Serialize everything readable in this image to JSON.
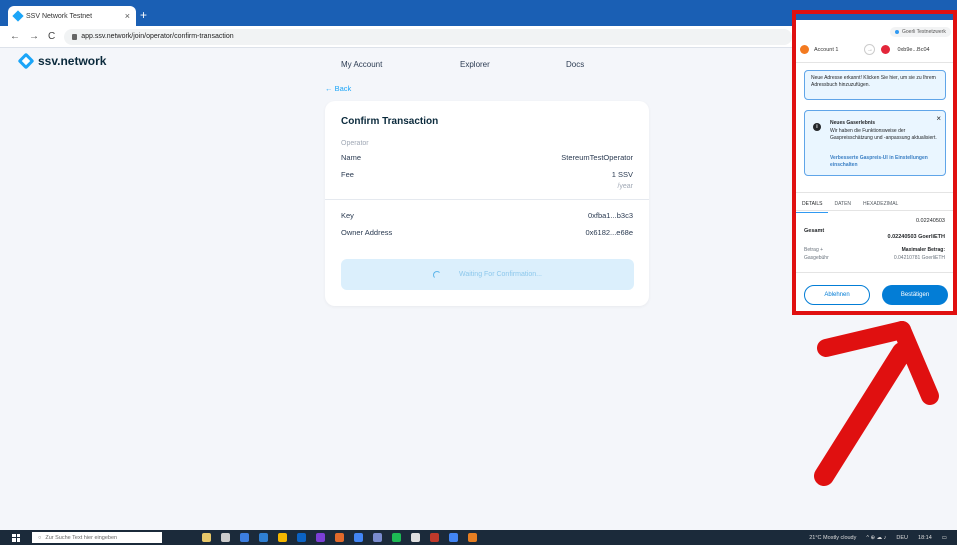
{
  "browser": {
    "tab_title": "SSV Network Testnet",
    "tab_close": "×",
    "new_tab": "+",
    "url": "app.ssv.network/join/operator/confirm-transaction",
    "back": "←",
    "forward": "→",
    "reload": "C"
  },
  "app": {
    "logo_text": "ssv.network",
    "nav": [
      "My Account",
      "Explorer",
      "Docs"
    ],
    "back_link": "← Back",
    "card": {
      "title": "Confirm Transaction",
      "section_label": "Operator",
      "name_label": "Name",
      "name_value": "StereumTestOperator",
      "fee_label": "Fee",
      "fee_value": "1 SSV",
      "fee_unit": "/year",
      "key_label": "Key",
      "key_value": "0xfba1...b3c3",
      "owner_label": "Owner Address",
      "owner_value": "0x6182...e68e",
      "waiting_text": "Waiting For Confirmation..."
    }
  },
  "metamask": {
    "network": "Goerli Testnetzwerk",
    "from_account": "Account 1",
    "to_address": "0xb9e...Bc04",
    "address_notice": "Neue Adresse erkannt! Klicken Sie hier, um sie zu Ihrem Adressbuch hinzuzufügen.",
    "gas_title": "Neues Gaserlebnis",
    "gas_body": "Wir haben die Funktionsweise der Gaspreisschätzung und -anpassung aktualisiert.",
    "gas_link": "Verbesserte Gaspreis-UI in Einstellungen einschalten",
    "gas_close": "×",
    "tabs": [
      "DETAILS",
      "DATEN",
      "HEXADEZIMAL"
    ],
    "total_small": "0.02240503",
    "total_label": "Gesamt",
    "total_value": "0.02240503 GoerliETH",
    "amount_label_1": "Betrag +",
    "amount_label_2": "Gasgebühr",
    "max_label": "Maximaler Betrag:",
    "max_value": "0.04210781 GoerliETH",
    "reject": "Ablehnen",
    "confirm": "Bestätigen"
  },
  "taskbar": {
    "search_placeholder": "Zur Suche Text hier eingeben",
    "weather": "21°C Mostly cloudy",
    "lang": "DEU",
    "time": "18:14"
  },
  "colors": {
    "ssv_blue": "#1ba5f8",
    "highlight_red": "#e01010",
    "metamask_blue": "#037dd6"
  }
}
